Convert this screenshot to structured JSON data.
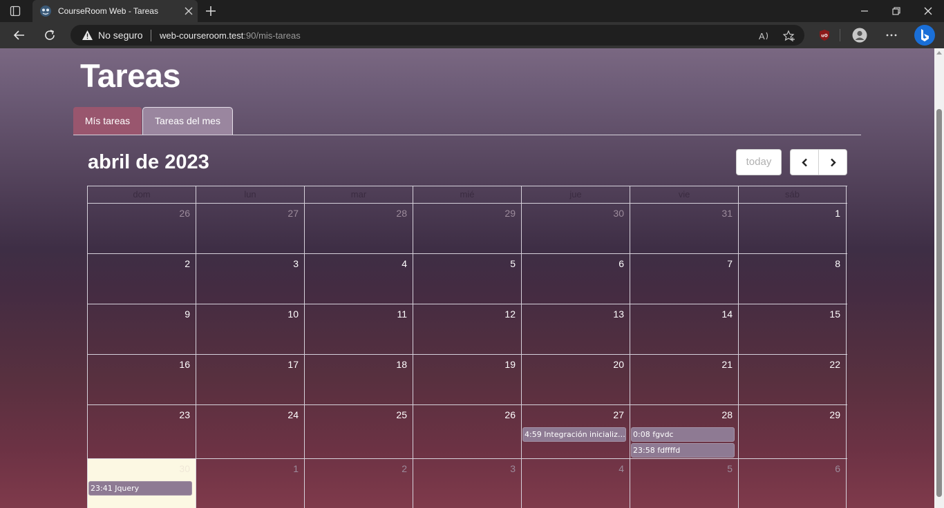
{
  "browser": {
    "tab_title": "CourseRoom Web - Tareas",
    "security_label": "No seguro",
    "url_host": "web-courseroom.test",
    "url_rest": ":90/mis-tareas"
  },
  "page": {
    "title": "Tareas",
    "tabs": [
      {
        "label": "Mís tareas",
        "active": true
      },
      {
        "label": "Tareas del mes",
        "active": false
      }
    ]
  },
  "calendar": {
    "title": "abril de 2023",
    "today_label": "today",
    "weekdays": [
      "dom",
      "lun",
      "mar",
      "mié",
      "jue",
      "vie",
      "sáb"
    ],
    "weeks": [
      [
        {
          "n": "26",
          "other": true
        },
        {
          "n": "27",
          "other": true
        },
        {
          "n": "28",
          "other": true
        },
        {
          "n": "29",
          "other": true
        },
        {
          "n": "30",
          "other": true
        },
        {
          "n": "31",
          "other": true
        },
        {
          "n": "1"
        }
      ],
      [
        {
          "n": "2"
        },
        {
          "n": "3"
        },
        {
          "n": "4"
        },
        {
          "n": "5"
        },
        {
          "n": "6"
        },
        {
          "n": "7"
        },
        {
          "n": "8"
        }
      ],
      [
        {
          "n": "9"
        },
        {
          "n": "10"
        },
        {
          "n": "11"
        },
        {
          "n": "12"
        },
        {
          "n": "13"
        },
        {
          "n": "14"
        },
        {
          "n": "15"
        }
      ],
      [
        {
          "n": "16"
        },
        {
          "n": "17"
        },
        {
          "n": "18"
        },
        {
          "n": "19"
        },
        {
          "n": "20"
        },
        {
          "n": "21"
        },
        {
          "n": "22"
        }
      ],
      [
        {
          "n": "23"
        },
        {
          "n": "24"
        },
        {
          "n": "25"
        },
        {
          "n": "26"
        },
        {
          "n": "27",
          "events": [
            "4:59 Integración inicializa..."
          ]
        },
        {
          "n": "28",
          "events": [
            "0:08 fgvdc",
            "23:58 fdffffd"
          ]
        },
        {
          "n": "29"
        }
      ],
      [
        {
          "n": "30",
          "today": true,
          "events": [
            "23:41 Jquery"
          ]
        },
        {
          "n": "1",
          "other": true
        },
        {
          "n": "2",
          "other": true
        },
        {
          "n": "3",
          "other": true
        },
        {
          "n": "4",
          "other": true
        },
        {
          "n": "5",
          "other": true
        },
        {
          "n": "6",
          "other": true
        }
      ]
    ]
  },
  "colors": {
    "active_tab": "#99566e",
    "event": "#8e7a93",
    "today_cell": "#fcf8e3"
  }
}
